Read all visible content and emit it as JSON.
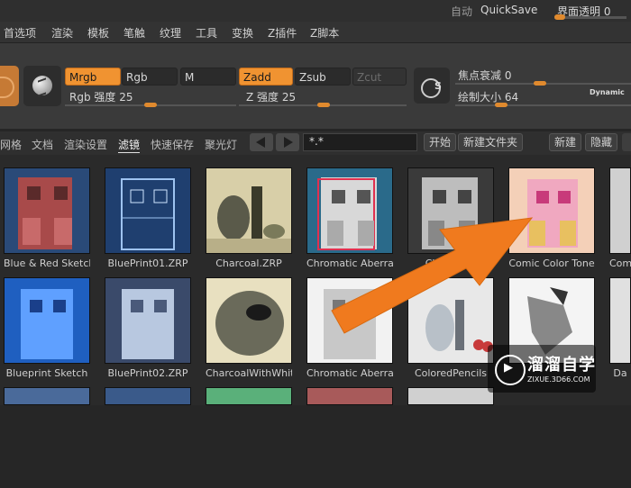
{
  "topbar": {
    "auto": "自动",
    "quicksave": "QuickSave",
    "transparency": "界面透明 0"
  },
  "menu": [
    "首选项",
    "渲染",
    "模板",
    "笔触",
    "纹理",
    "工具",
    "变换",
    "Z插件",
    "Z脚本"
  ],
  "toolbar": {
    "mrgb": "Mrgb",
    "rgb": "Rgb",
    "m": "M",
    "zadd": "Zadd",
    "zsub": "Zsub",
    "zcut": "Zcut",
    "rgb_intensity": "Rgb 强度 25",
    "z_intensity": "Z 强度 25",
    "focal_shift": "焦点衰减 0",
    "draw_size": "绘制大小 64",
    "dynamic": "Dynamic"
  },
  "palette": {
    "tabs": [
      "网格",
      "文档",
      "渲染设置",
      "滤镜",
      "快速保存",
      "聚光灯"
    ],
    "active_tab": "滤镜",
    "search_value": "*.*",
    "start": "开始",
    "new_folder": "新建文件夹",
    "new": "新建",
    "hide": "隐藏"
  },
  "thumbnails": [
    {
      "caption": "Blue & Red Sketch"
    },
    {
      "caption": "BluePrint01.ZRP"
    },
    {
      "caption": "Charcoal.ZRP"
    },
    {
      "caption": "Chromatic Aberration"
    },
    {
      "caption": "Chromatic"
    },
    {
      "caption": "Comic Color Tone"
    },
    {
      "caption": "Com"
    },
    {
      "caption": "Blueprint Sketch"
    },
    {
      "caption": "BluePrint02.ZRP"
    },
    {
      "caption": "CharcoalWithWhite"
    },
    {
      "caption": "Chromatic Aberration"
    },
    {
      "caption": "ColoredPencils"
    },
    {
      "caption": ""
    },
    {
      "caption": "Da"
    }
  ],
  "watermark": {
    "main": "溜溜自学",
    "sub": "ZIXUE.3D66.COM"
  },
  "colors": {
    "accent": "#f09331",
    "arrow": "#f07a1e"
  }
}
